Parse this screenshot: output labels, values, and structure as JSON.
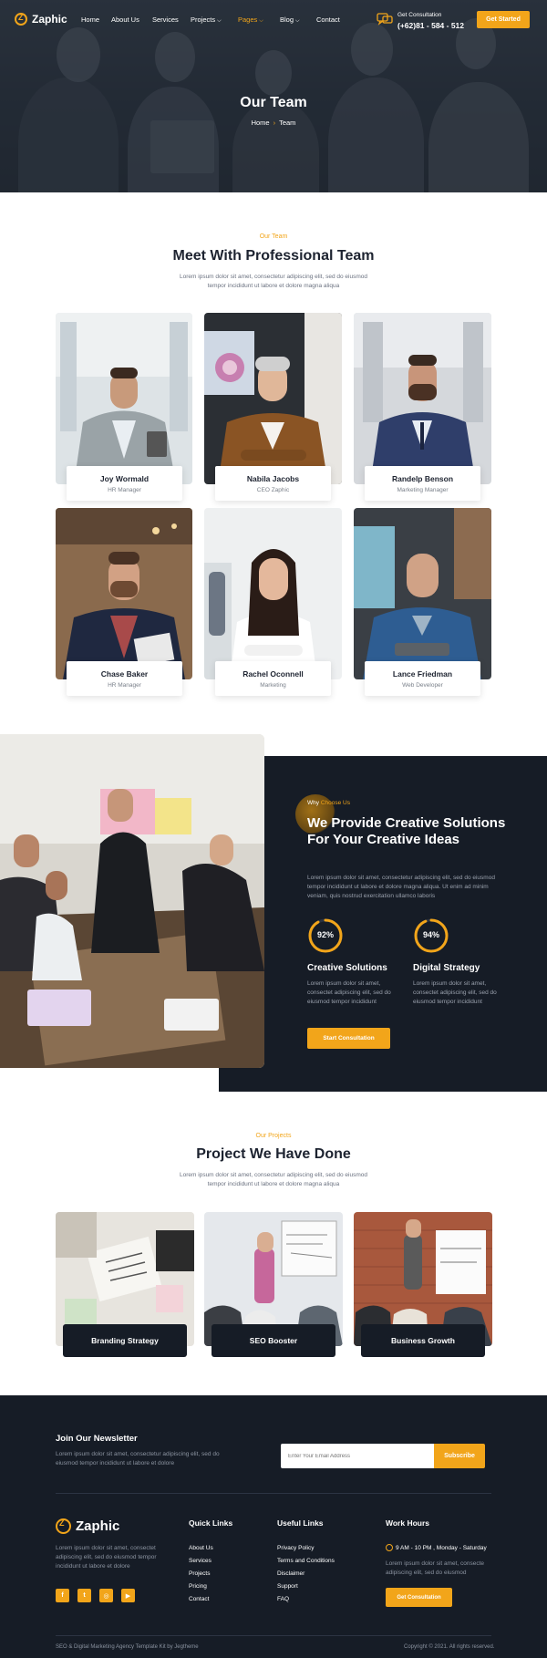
{
  "brand": {
    "name": "Zaphic",
    "accent": "#f2a51a",
    "dark": "#161c26"
  },
  "nav": {
    "items": [
      {
        "label": "Home",
        "caret": false,
        "active": false
      },
      {
        "label": "About Us",
        "caret": false,
        "active": false
      },
      {
        "label": "Services",
        "caret": false,
        "active": false
      },
      {
        "label": "Projects",
        "caret": true,
        "active": false
      },
      {
        "label": "Pages",
        "caret": true,
        "active": true
      },
      {
        "label": "Blog",
        "caret": true,
        "active": false
      },
      {
        "label": "Contact",
        "caret": false,
        "active": false
      }
    ],
    "consult_label": "Get Consultation",
    "consult_phone": "(+62)81 - 584 - 512",
    "cta": "Get Started",
    "icons": [
      "logo-icon",
      "chat-icon",
      "chevron-down-icon"
    ]
  },
  "hero": {
    "title": "Our Team",
    "breadcrumb": {
      "home": "Home",
      "current": "Team"
    }
  },
  "team": {
    "eyebrow": "Our Team",
    "title": "Meet With Professional Team",
    "lead_1": "Lorem ipsum dolor sit amet, consectetur adipiscing elit, sed do eiusmod",
    "lead_2": "tempor incididunt ut labore et dolore magna aliqua",
    "members": [
      {
        "name": "Joy Wormald",
        "role": "HR Manager"
      },
      {
        "name": "Nabila Jacobs",
        "role": "CEO Zaphic"
      },
      {
        "name": "Randelp Benson",
        "role": "Marketing Manager"
      },
      {
        "name": "Chase Baker",
        "role": "HR Manager"
      },
      {
        "name": "Rachel Oconnell",
        "role": "Marketing"
      },
      {
        "name": "Lance Friedman",
        "role": "Web Developer"
      }
    ]
  },
  "why": {
    "eyebrow_a": "Why",
    "eyebrow_b": "Choose Us",
    "title": "We Provide Creative Solutions For Your Creative Ideas",
    "lead": "Lorem ipsum dolor sit amet, consectetur adipiscing elit, sed do eiusmod tempor incididunt ut labore et dolore magna aliqua. Ut enim ad minim veniam, quis nostrud exercitation ullamco laboris",
    "stats": [
      {
        "percent": 92,
        "label": "92%",
        "title": "Creative Solutions",
        "text": "Lorem ipsum dolor sit amet, consectet adipiscing elit, sed do eiusmod tempor incididunt"
      },
      {
        "percent": 94,
        "label": "94%",
        "title": "Digital Strategy",
        "text": "Lorem ipsum dolor sit amet, consectet adipiscing elit, sed do eiusmod tempor incididunt"
      }
    ],
    "cta": "Start Consultation"
  },
  "projects": {
    "eyebrow": "Our Projects",
    "title": "Project We Have Done",
    "lead_1": "Lorem ipsum dolor sit amet, consectetur adipiscing elit, sed do eiusmod",
    "lead_2": "tempor incididunt ut labore et dolore magna aliqua",
    "items": [
      {
        "label": "Branding Strategy"
      },
      {
        "label": "SEO Booster"
      },
      {
        "label": "Business Growth"
      }
    ]
  },
  "newsletter": {
    "title": "Join Our Newsletter",
    "text_1": "Lorem ipsum dolor sit amet, consectetur adipiscing elit, sed do",
    "text_2": "eiusmod tempor incididunt ut labore et dolore",
    "placeholder": "Enter Your Email Address",
    "button": "Subscribe"
  },
  "footer": {
    "about_1": "Lorem ipsum dolor sit amet, consectet",
    "about_2": "adipiscing elit, sed do eiusmod tempor",
    "about_3": "incididunt ut labore et dolore",
    "social": [
      {
        "glyph": "f",
        "icon": "facebook-icon"
      },
      {
        "glyph": "t",
        "icon": "twitter-icon"
      },
      {
        "glyph": "◎",
        "icon": "instagram-icon"
      },
      {
        "glyph": "▶",
        "icon": "youtube-icon"
      }
    ],
    "quick_title": "Quick Links",
    "quick_links": [
      "About Us",
      "Services",
      "Projects",
      "Pricing",
      "Contact"
    ],
    "useful_title": "Useful Links",
    "useful_links": [
      "Privacy Policy",
      "Terms and Conditions",
      "Disclaimer",
      "Support",
      "FAQ"
    ],
    "hours_title": "Work Hours",
    "hours": "9 AM - 10 PM , Monday - Saturday",
    "hours_text_1": "Lorem ipsum dolor sit amet, consecte",
    "hours_text_2": "adipiscing elit, sed do eiusmod",
    "hours_cta": "Get Consultation",
    "credit": "SEO & Digital Marketing Agency Template Kit by Jegtheme",
    "copyright": "Copyright © 2021. All rights reserved."
  }
}
